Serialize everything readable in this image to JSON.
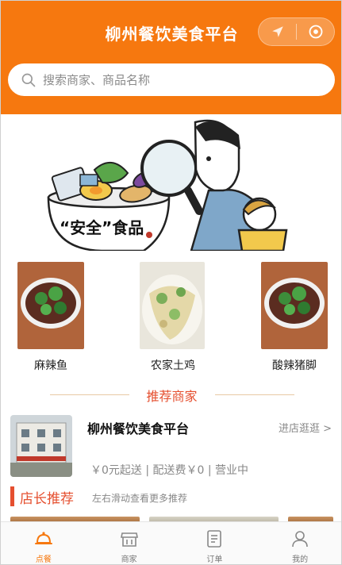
{
  "header": {
    "title": "柳州餐饮美食平台"
  },
  "search": {
    "placeholder": "搜索商家、商品名称"
  },
  "banner": {
    "caption": "“安全”食品"
  },
  "dishes": [
    {
      "name": "麻辣鱼"
    },
    {
      "name": "农家土鸡"
    },
    {
      "name": "酸辣猪脚"
    }
  ],
  "section": {
    "recommended_merchants": "推荐商家"
  },
  "merchant": {
    "name": "柳州餐饮美食平台",
    "visit_label": "进店逛逛 >",
    "info": "￥0元起送 | 配送费￥0 | 营业中"
  },
  "manager_recommend": {
    "title": "店长推荐",
    "hint": "左右滑动查看更多推荐"
  },
  "tabbar": {
    "items": [
      {
        "label": "点餐",
        "icon": "dining-bell-icon",
        "active": true
      },
      {
        "label": "商家",
        "icon": "shop-icon",
        "active": false
      },
      {
        "label": "订单",
        "icon": "order-list-icon",
        "active": false
      },
      {
        "label": "我的",
        "icon": "user-icon",
        "active": false
      }
    ]
  },
  "colors": {
    "brand_orange": "#f6780f",
    "accent_red": "#e54f2f"
  }
}
